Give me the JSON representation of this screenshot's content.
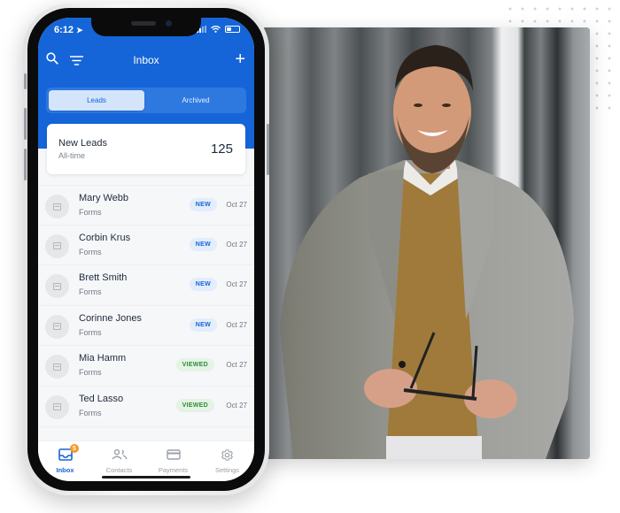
{
  "phone": {
    "status_bar": {
      "time": "6:12",
      "location_icon": "location-arrow-icon",
      "icons": [
        "signal-icon",
        "wifi-icon",
        "battery-icon"
      ]
    },
    "header": {
      "title": "Inbox",
      "search_icon": "search-icon",
      "filter_icon": "filter-icon",
      "add_icon": "plus-icon",
      "add_glyph": "+"
    },
    "segments": [
      {
        "label": "Leads",
        "active": true
      },
      {
        "label": "Archived",
        "active": false
      }
    ],
    "summary": {
      "title": "New Leads",
      "subtitle": "All-time",
      "count": "125"
    },
    "leads": [
      {
        "name": "Mary Webb",
        "source": "Forms",
        "status": "NEW",
        "date": "Oct 27"
      },
      {
        "name": "Corbin Krus",
        "source": "Forms",
        "status": "NEW",
        "date": "Oct 27"
      },
      {
        "name": "Brett Smith",
        "source": "Forms",
        "status": "NEW",
        "date": "Oct 27"
      },
      {
        "name": "Corinne Jones",
        "source": "Forms",
        "status": "NEW",
        "date": "Oct 27"
      },
      {
        "name": "Mia Hamm",
        "source": "Forms",
        "status": "VIEWED",
        "date": "Oct 27"
      },
      {
        "name": "Ted Lasso",
        "source": "Forms",
        "status": "VIEWED",
        "date": "Oct 27"
      }
    ],
    "tabbar": [
      {
        "label": "Inbox",
        "icon": "inbox-icon",
        "active": true,
        "badge": "5"
      },
      {
        "label": "Contacts",
        "icon": "contacts-icon",
        "active": false
      },
      {
        "label": "Payments",
        "icon": "credit-card-icon",
        "active": false
      },
      {
        "label": "Settings",
        "icon": "gear-icon",
        "active": false
      }
    ]
  },
  "photo": {
    "subject": "smiling man in grey checked blazer holding eyeglasses"
  },
  "colors": {
    "brand_blue": "#1565d8",
    "new_badge_bg": "#e3edfb",
    "viewed_badge_bg": "#e4f3e4",
    "viewed_badge_text": "#2e8b3a",
    "notification_orange": "#f59a23"
  }
}
